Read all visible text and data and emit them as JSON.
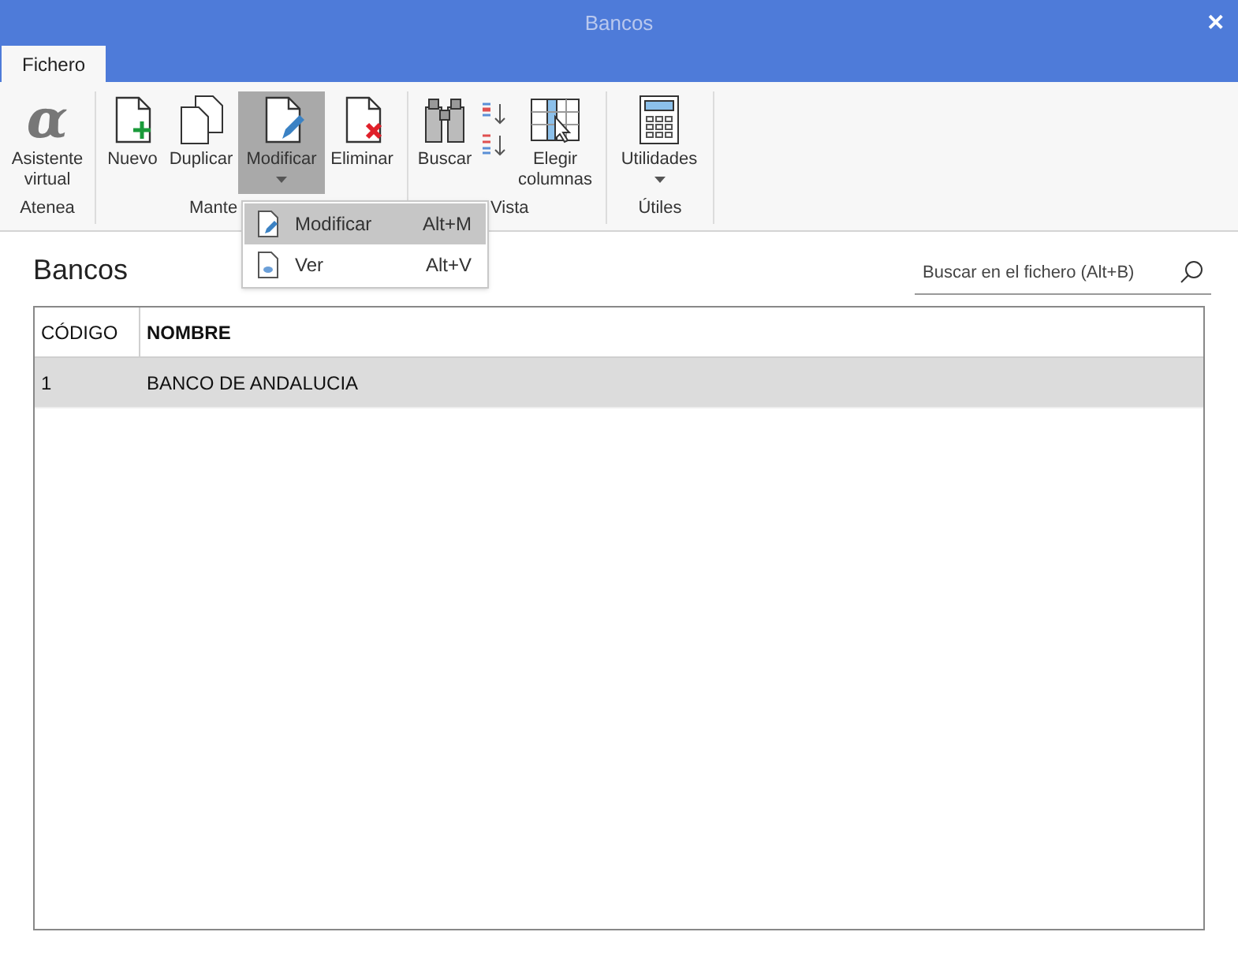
{
  "window": {
    "title": "Bancos",
    "close": "✕"
  },
  "tabs": [
    {
      "label": "Fichero",
      "selected": true
    }
  ],
  "ribbon": {
    "groups": [
      {
        "label": "Atenea",
        "buttons": [
          {
            "kind": "alpha",
            "glyph": "α",
            "label": "Asistente virtual",
            "selected": false,
            "dropdown": false
          }
        ]
      },
      {
        "label": "Mante",
        "buttons": [
          {
            "kind": "new",
            "label": "Nuevo",
            "selected": false,
            "dropdown": false
          },
          {
            "kind": "duplicate",
            "label": "Duplicar",
            "selected": false,
            "dropdown": false
          },
          {
            "kind": "edit",
            "label": "Modificar",
            "selected": true,
            "dropdown": true
          },
          {
            "kind": "delete",
            "label": "Eliminar",
            "selected": false,
            "dropdown": false
          }
        ]
      },
      {
        "label": "Vista",
        "buttons": [
          {
            "kind": "binoculars",
            "label": "Buscar",
            "selected": false,
            "dropdown": false
          },
          {
            "kind": "sort",
            "selected": false,
            "dropdown": false
          },
          {
            "kind": "columns",
            "label": "Elegir columnas",
            "selected": false,
            "dropdown": false
          }
        ]
      },
      {
        "label": "Útiles",
        "buttons": [
          {
            "kind": "calculator",
            "label": "Utilidades",
            "selected": false,
            "dropdown": true
          }
        ]
      }
    ]
  },
  "menu": {
    "items": [
      {
        "kind": "edit",
        "label": "Modificar",
        "shortcut": "Alt+M",
        "selected": true
      },
      {
        "kind": "view",
        "label": "Ver",
        "shortcut": "Alt+V",
        "selected": false
      }
    ]
  },
  "heading": "Bancos",
  "search": {
    "placeholder": "Buscar en el fichero (Alt+B)"
  },
  "table": {
    "columns": [
      {
        "label": "CÓDIGO",
        "bold": false
      },
      {
        "label": "NOMBRE",
        "bold": true
      }
    ],
    "rows": [
      {
        "cells": [
          "1",
          "BANCO DE ANDALUCIA"
        ],
        "selected": true
      }
    ]
  }
}
